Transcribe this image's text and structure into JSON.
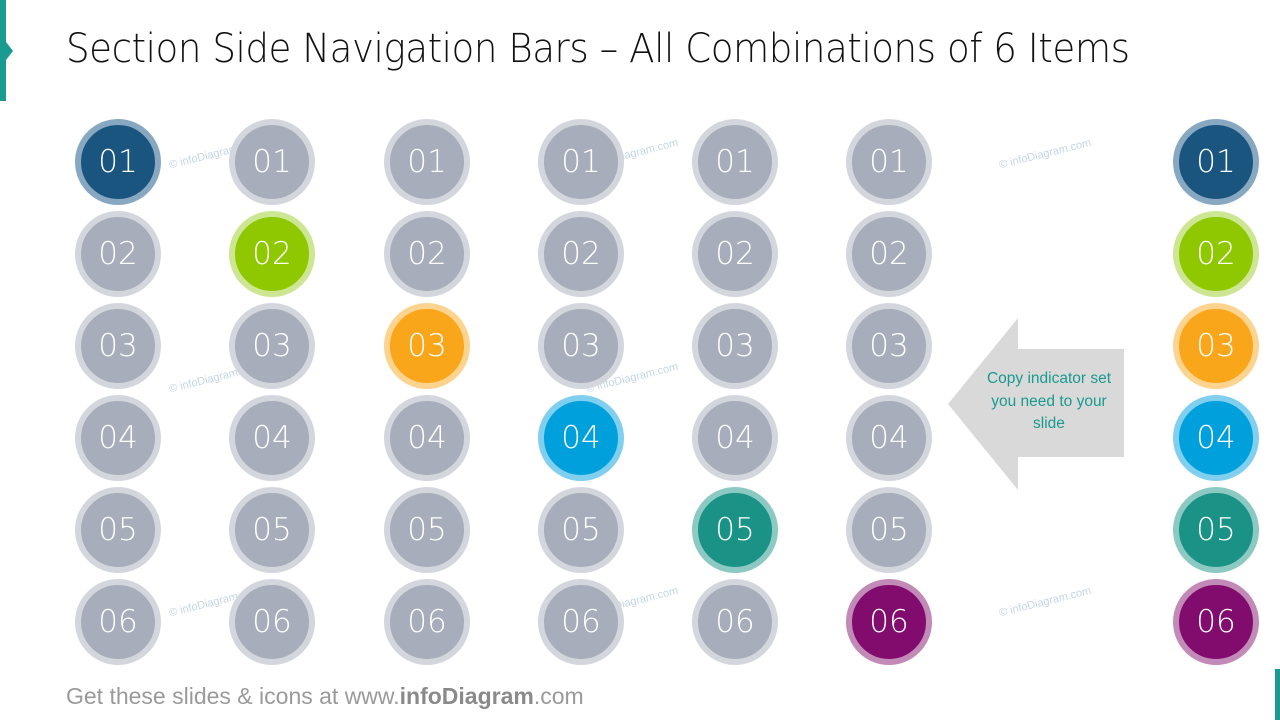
{
  "title": "Section Side Navigation Bars – All Combinations of 6 Items",
  "items": [
    "01",
    "02",
    "03",
    "04",
    "05",
    "06"
  ],
  "colors": {
    "inactive_fill": "#a7adba",
    "inactive_ring": "#d3d6dd",
    "active": [
      {
        "fill": "#1a5580",
        "ring": "#88a8c2"
      },
      {
        "fill": "#8fc800",
        "ring": "#cde693"
      },
      {
        "fill": "#faa61a",
        "ring": "#fcd490"
      },
      {
        "fill": "#00a0dc",
        "ring": "#80cfee"
      },
      {
        "fill": "#1a9286",
        "ring": "#8cc9c2"
      },
      {
        "fill": "#820c6e",
        "ring": "#c18ab7"
      }
    ]
  },
  "combinations": [
    {
      "active_index": 0
    },
    {
      "active_index": 1
    },
    {
      "active_index": 2
    },
    {
      "active_index": 3
    },
    {
      "active_index": 4
    },
    {
      "active_index": 5
    }
  ],
  "full_set": {
    "all_active": true
  },
  "callout": {
    "text": "Copy indicator set you need to your slide"
  },
  "watermark": "© infoDiagram.com",
  "footer": {
    "prefix": "Get these slides & icons at www.",
    "brand": "infoDiagram",
    "suffix": ".com"
  }
}
